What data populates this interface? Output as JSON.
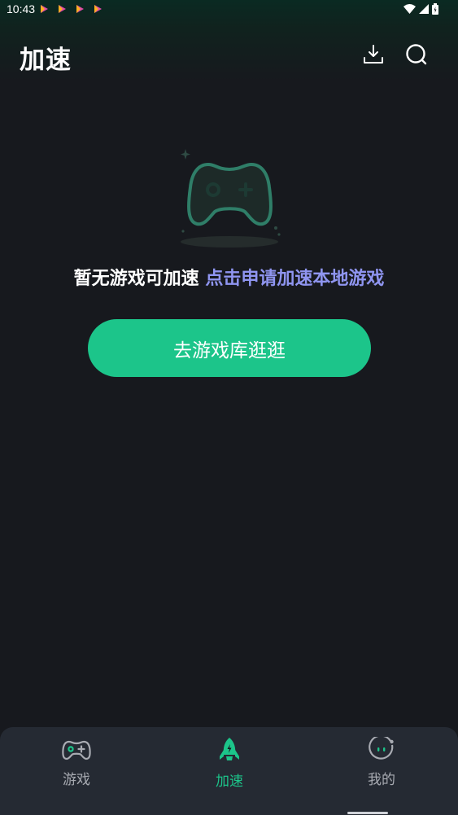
{
  "status_bar": {
    "time": "10:43"
  },
  "header": {
    "title": "加速"
  },
  "empty_state": {
    "message": "暂无游戏可加速",
    "link_text": "点击申请加速本地游戏",
    "button_label": "去游戏库逛逛"
  },
  "bottom_nav": {
    "items": [
      {
        "label": "游戏",
        "icon": "gamepad-icon"
      },
      {
        "label": "加速",
        "icon": "rocket-icon",
        "active": true
      },
      {
        "label": "我的",
        "icon": "profile-face-icon"
      }
    ]
  },
  "colors": {
    "background": "#17191e",
    "accent": "#1cc58a",
    "link": "#8f95f0",
    "nav_background": "#252a33"
  }
}
